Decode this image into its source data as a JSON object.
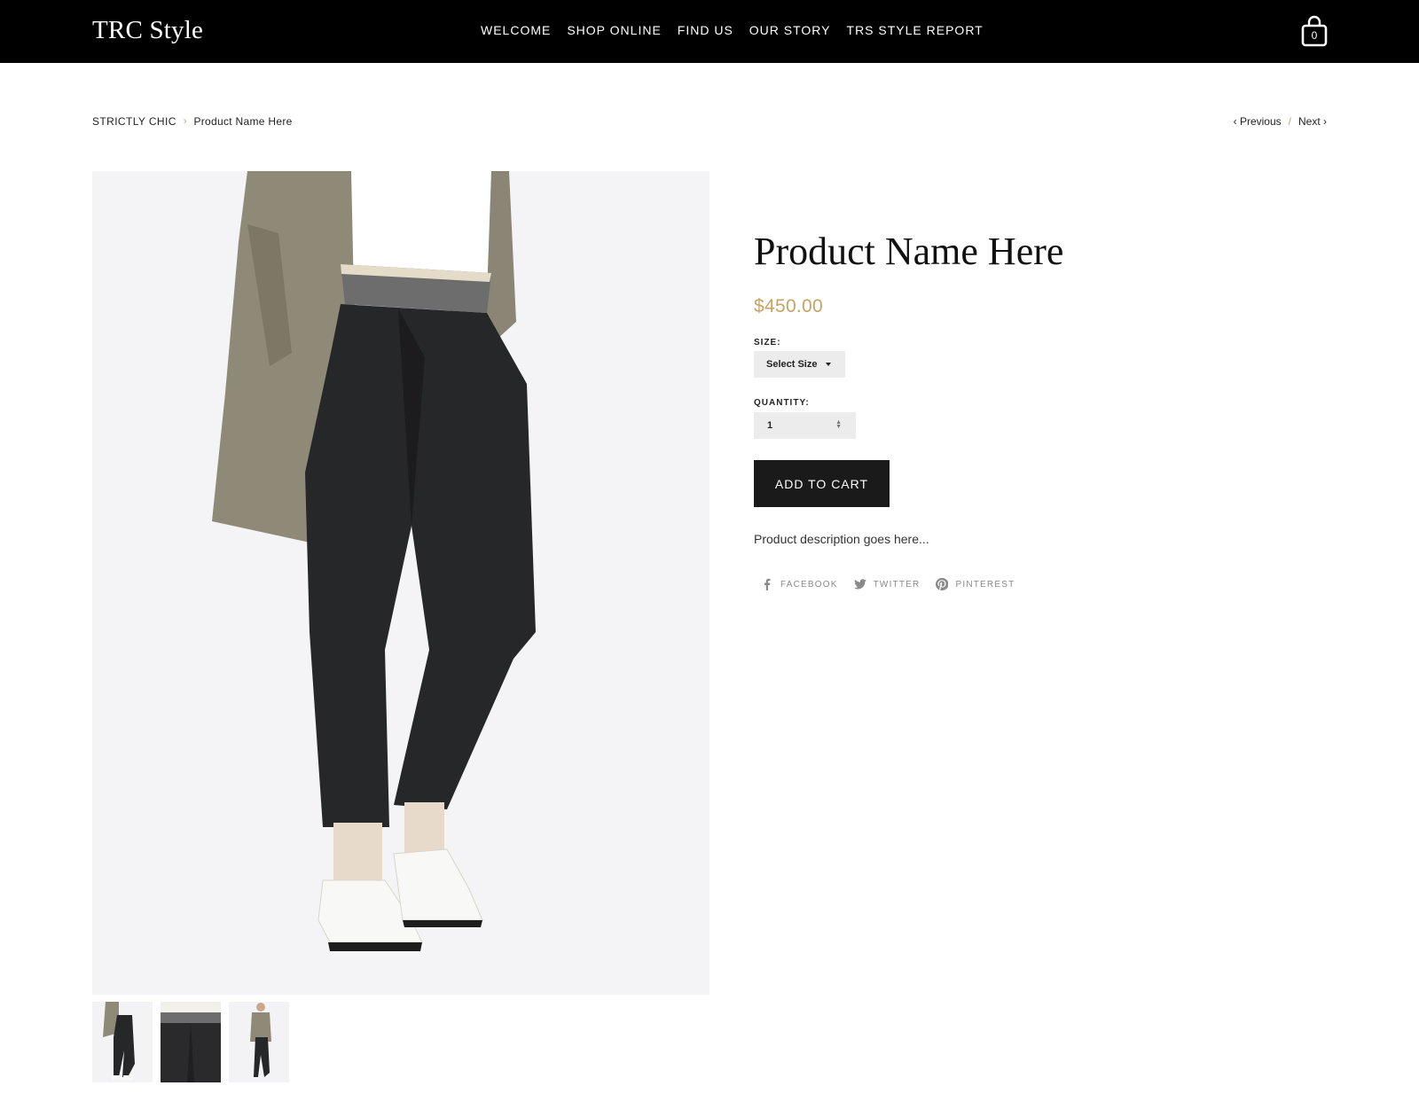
{
  "header": {
    "logo": "TRC Style",
    "nav": [
      "WELCOME",
      "SHOP ONLINE",
      "FIND US",
      "OUR STORY",
      "TRS STYLE REPORT"
    ],
    "cart_count": "0"
  },
  "breadcrumb": {
    "parent": "STRICTLY CHIC",
    "separator": "›",
    "current": "Product Name Here"
  },
  "pager": {
    "previous": "‹ Previous",
    "separator": "/",
    "next": "Next ›"
  },
  "product": {
    "title": "Product Name Here",
    "price": "$450.00",
    "size_label": "SIZE:",
    "size_value": "Select Size",
    "quantity_label": "QUANTITY:",
    "quantity_value": "1",
    "add_to_cart": "ADD TO CART",
    "description": "Product description goes here..."
  },
  "share": {
    "facebook": "FACEBOOK",
    "twitter": "TWITTER",
    "pinterest": "PINTEREST"
  },
  "colors": {
    "header_bg": "#000000",
    "accent": "#c8a164",
    "button_bg": "#1a1a1a"
  }
}
